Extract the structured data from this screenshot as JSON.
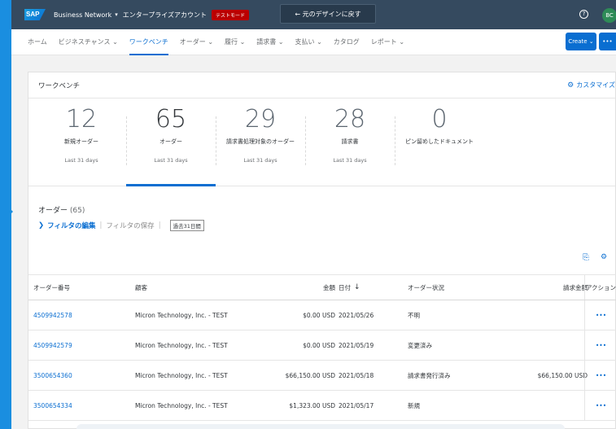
{
  "shell": {
    "logo": "SAP",
    "product": "Business Network",
    "account": "エンタープライズアカウント",
    "test_badge": "テストモード",
    "back_design": "← 元のデザインに戻す",
    "help_icon": "?",
    "avatar": "BC"
  },
  "nav": {
    "items": [
      {
        "label": "ホーム"
      },
      {
        "label": "ビジネスチャンス ⌄"
      },
      {
        "label": "ワークベンチ"
      },
      {
        "label": "オーダー ⌄"
      },
      {
        "label": "履行 ⌄"
      },
      {
        "label": "請求書 ⌄"
      },
      {
        "label": "支払い ⌄"
      },
      {
        "label": "カタログ"
      },
      {
        "label": "レポート ⌄"
      }
    ],
    "active_index": 2,
    "create_label": "Create ⌄",
    "more_label": "•••"
  },
  "workbench": {
    "title": "ワークベンチ",
    "customize_label": "カスタマイズ",
    "tiles": [
      {
        "value": "12",
        "label": "新規オーダー",
        "period": "Last 31 days"
      },
      {
        "value": "65",
        "label": "オーダー",
        "period": "Last 31 days"
      },
      {
        "value": "29",
        "label": "請求書処理対象のオーダー",
        "period": "Last 31 days"
      },
      {
        "value": "28",
        "label": "請求書",
        "period": "Last 31 days"
      },
      {
        "value": "0",
        "label": "ピン留めしたドキュメント",
        "period": ""
      }
    ],
    "active_tile": 1
  },
  "orders": {
    "title": "オーダー",
    "count": "(65)",
    "filter_edit": "フィルタの編集",
    "filter_save": "フィルタの保存",
    "period_tag": "過去31日間",
    "columns": {
      "order": "オーダー番号",
      "customer": "顧客",
      "amount": "金額",
      "date": "日付",
      "status": "オーダー状況",
      "invoiced": "請求金額",
      "action": "アクション"
    },
    "rows": [
      {
        "order": "4509942578",
        "customer": "Micron Technology, Inc. - TEST",
        "amount": "$0.00 USD",
        "date": "2021/05/26",
        "status": "不明",
        "invoiced": "",
        "action": "•••"
      },
      {
        "order": "4509942579",
        "customer": "Micron Technology, Inc. - TEST",
        "amount": "$0.00 USD",
        "date": "2021/05/19",
        "status": "変更済み",
        "invoiced": "",
        "action": "•••"
      },
      {
        "order": "3500654360",
        "customer": "Micron Technology, Inc. - TEST",
        "amount": "$66,150.00 USD",
        "date": "2021/05/18",
        "status": "請求書発行済み",
        "invoiced": "$66,150.00 USD",
        "action": "•••"
      },
      {
        "order": "3500654334",
        "customer": "Micron Technology, Inc. - TEST",
        "amount": "$1,323.00 USD",
        "date": "2021/05/17",
        "status": "新規",
        "invoiced": "",
        "action": "•••"
      }
    ]
  }
}
